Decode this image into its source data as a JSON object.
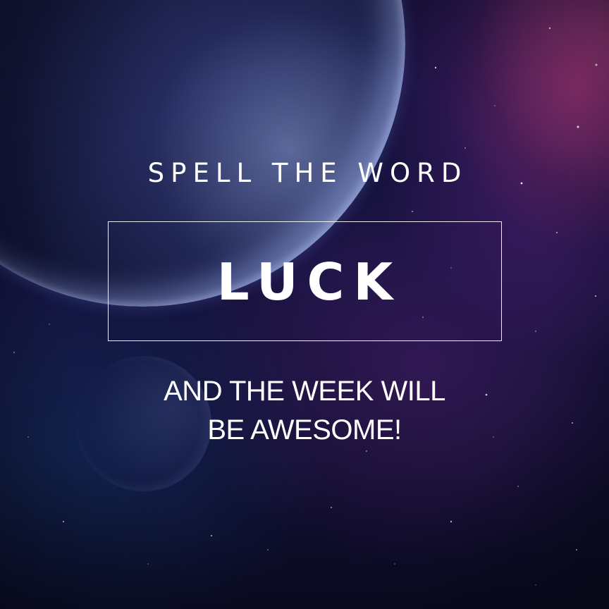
{
  "headline": "SPELL THE WORD",
  "word": "LUCK",
  "tagline": {
    "line1": "AND THE WEEK WILL",
    "line2": "BE AWESOME!"
  },
  "colors": {
    "text": "#ffffff",
    "background": "#0c0f33",
    "nebula_accent": "#d63c96"
  }
}
